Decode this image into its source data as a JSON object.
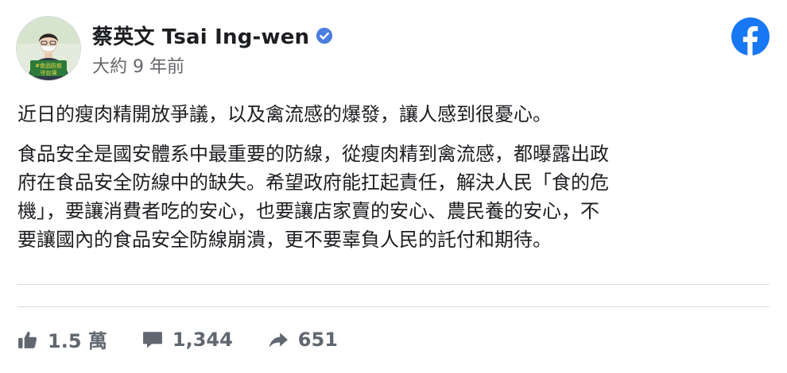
{
  "header": {
    "name": "蔡英文 Tsai Ing-wen",
    "time": "大約 9 年前",
    "avatar_sign_line1": "#食品防疫",
    "avatar_sign_line2": "守台灣"
  },
  "post": {
    "paragraph1": "近日的瘦肉精開放爭議，以及禽流感的爆發，讓人感到很憂心。",
    "paragraph2_lines": [
      "食品安全是國安體系中最重要的防線，從瘦肉精到禽流感，都曝露出政",
      "府在食品安全防線中的缺失。希望政府能扛起責任，解決人民「食的危",
      "機」，要讓消費者吃的安心，也要讓店家賣的安心、農民養的安心，不",
      "要讓國內的食品安全防線崩潰，更不要辜負人民的託付和期待。"
    ]
  },
  "stats": {
    "likes": "1.5 萬",
    "comments": "1,344",
    "shares": "651"
  },
  "colors": {
    "facebook_blue": "#1877f2",
    "verified_blue": "#4b7ee0",
    "stat_gray": "#606770",
    "divider": "#dadde1"
  },
  "icons": [
    "verified-badge-icon",
    "facebook-logo-icon",
    "like-icon",
    "comment-icon",
    "share-icon"
  ]
}
